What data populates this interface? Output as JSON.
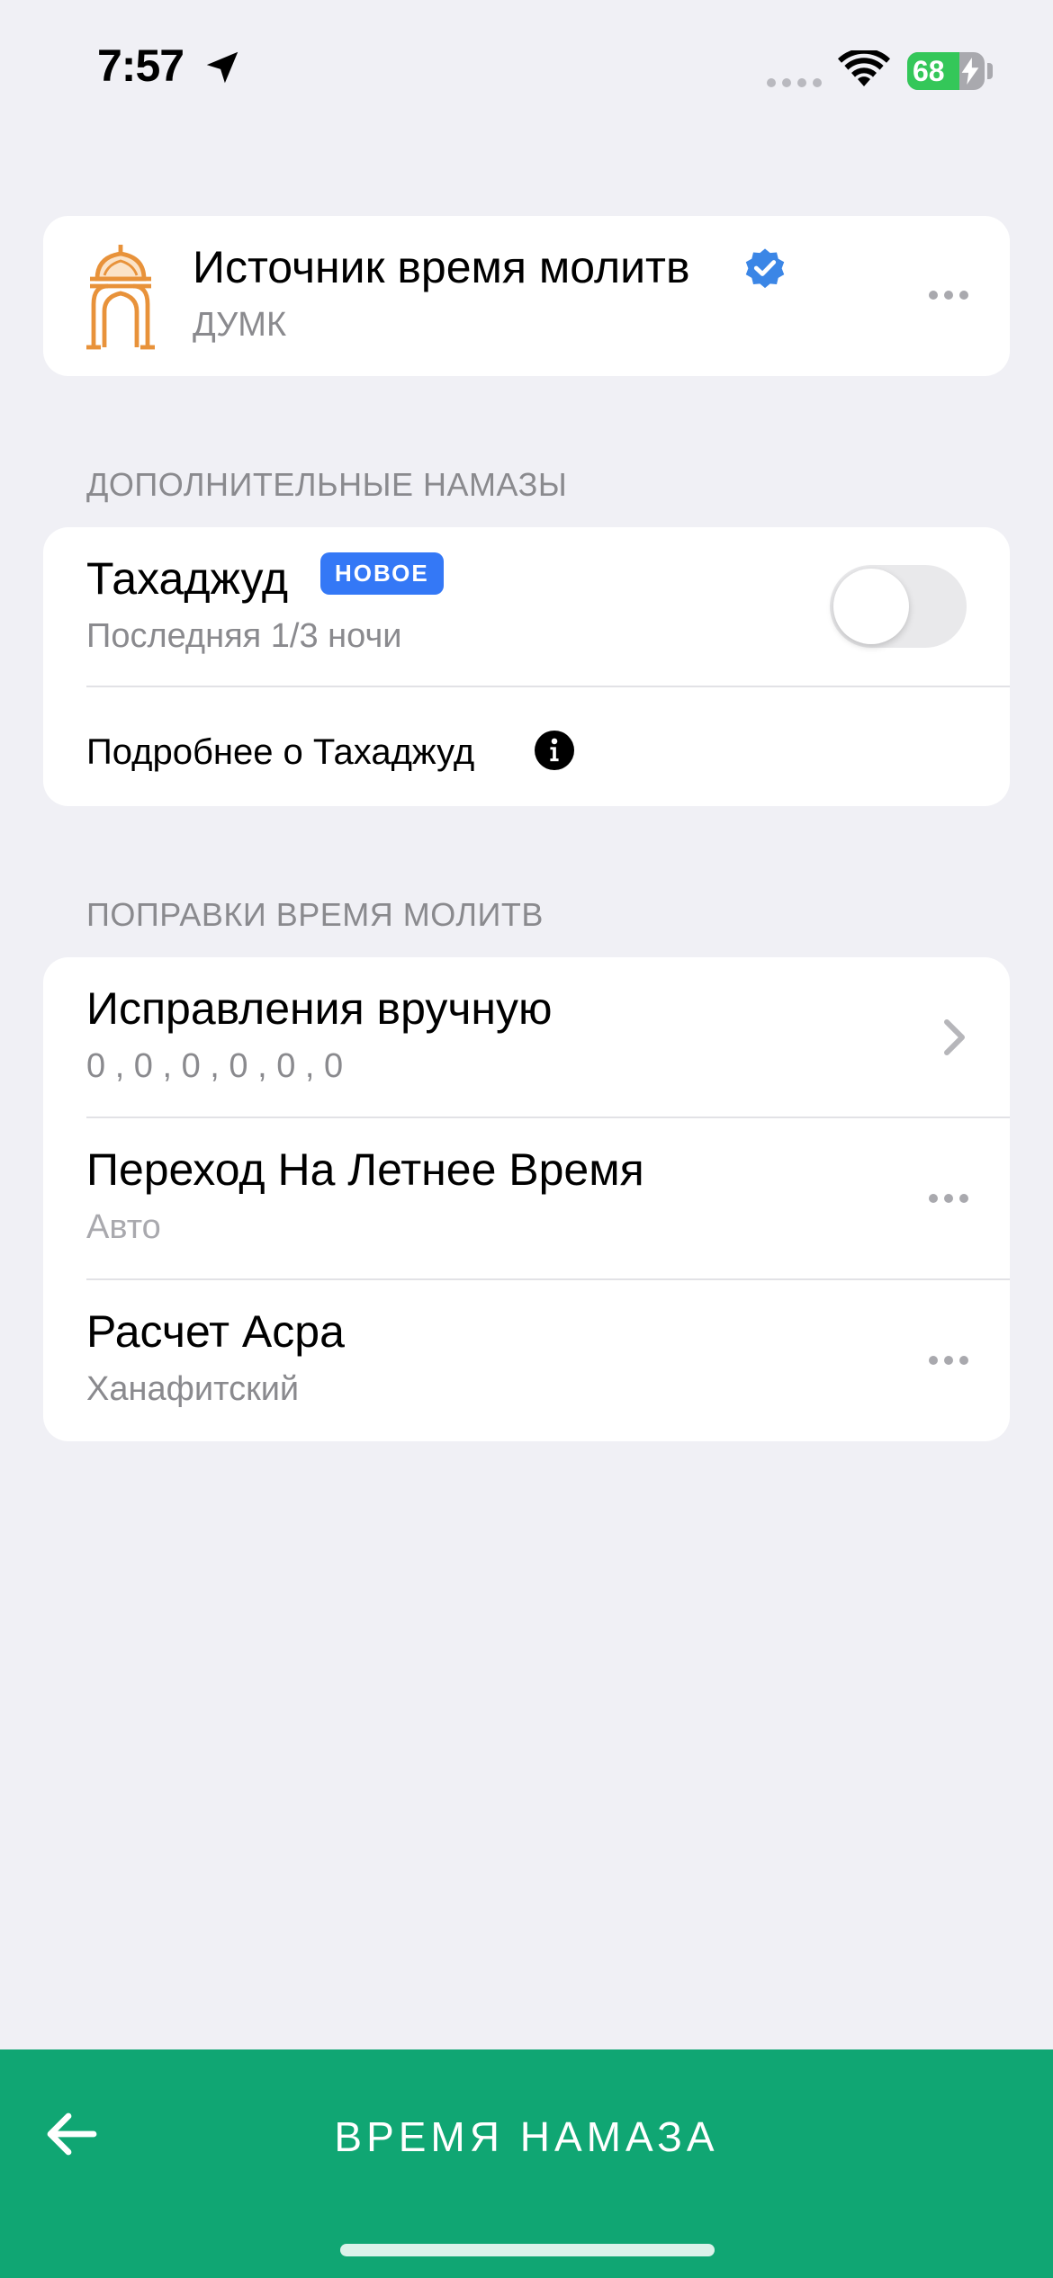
{
  "status_bar": {
    "time": "7:57",
    "battery_level": "68",
    "battery_color": "#34c759"
  },
  "source_card": {
    "title": "Источник время молитв",
    "subtitle": "ДУМК",
    "icon": "mosque-icon",
    "verified_icon": "verified-badge-icon"
  },
  "extra_prayers": {
    "header": "ДОПОЛНИТЕЛЬНЫЕ НАМАЗЫ",
    "tahajjud": {
      "title": "Тахаджуд",
      "badge": "НОВОЕ",
      "subtitle": "Последняя 1/3 ночи",
      "enabled": false
    },
    "more_info": "Подробнее о Тахаджуд"
  },
  "adjustments": {
    "header": "ПОПРАВКИ ВРЕМЯ МОЛИТВ",
    "items": [
      {
        "title": "Исправления вручную",
        "value": "0 , 0 , 0 , 0 , 0 , 0",
        "accessory": "chevron"
      },
      {
        "title": "Переход На Летнее Время",
        "value": "Авто",
        "accessory": "more"
      },
      {
        "title": "Расчет Асра",
        "value": "Ханафитский",
        "accessory": "more"
      }
    ]
  },
  "bottom_bar": {
    "title": "ВРЕМЯ НАМАЗА",
    "color": "#10a673"
  }
}
